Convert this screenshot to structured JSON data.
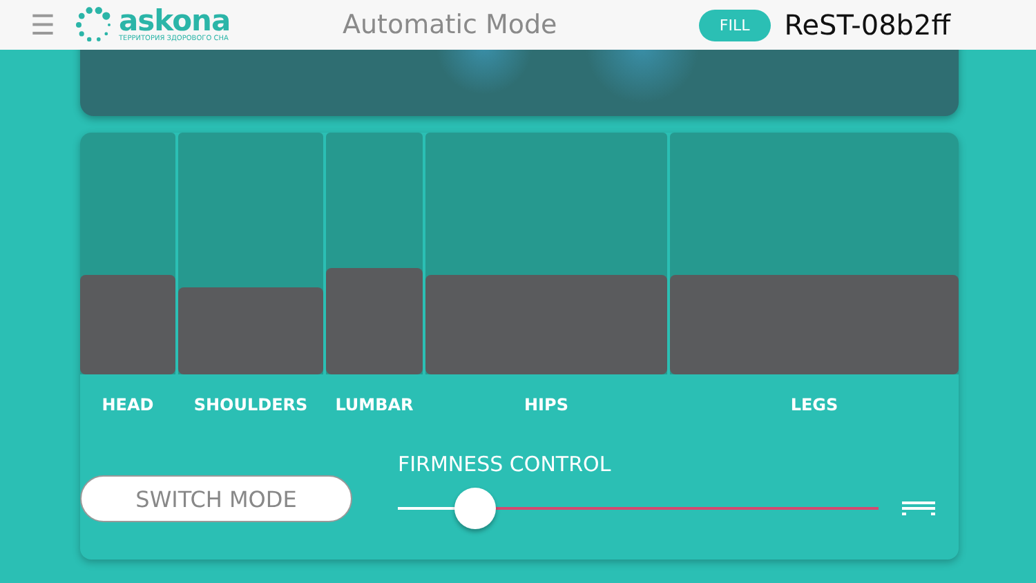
{
  "header": {
    "menu_icon": "☰",
    "logo": {
      "name": "askona",
      "tagline": "ТЕРРИТОРИЯ ЗДОРОВОГО СНА"
    },
    "title": "Automatic Mode",
    "status_badge": "FILL",
    "device_name": "ReST-08b2ff"
  },
  "zones": [
    {
      "label": "HEAD",
      "level": 0.33
    },
    {
      "label": "SHOULDERS",
      "level": 0.29
    },
    {
      "label": "LUMBAR",
      "level": 0.35
    },
    {
      "label": "HIPS",
      "level": 0.33
    },
    {
      "label": "LEGS",
      "level": 0.33
    }
  ],
  "switch_button": "SWITCH MODE",
  "firmness": {
    "label": "FIRMNESS CONTROL",
    "level": 0.16
  }
}
